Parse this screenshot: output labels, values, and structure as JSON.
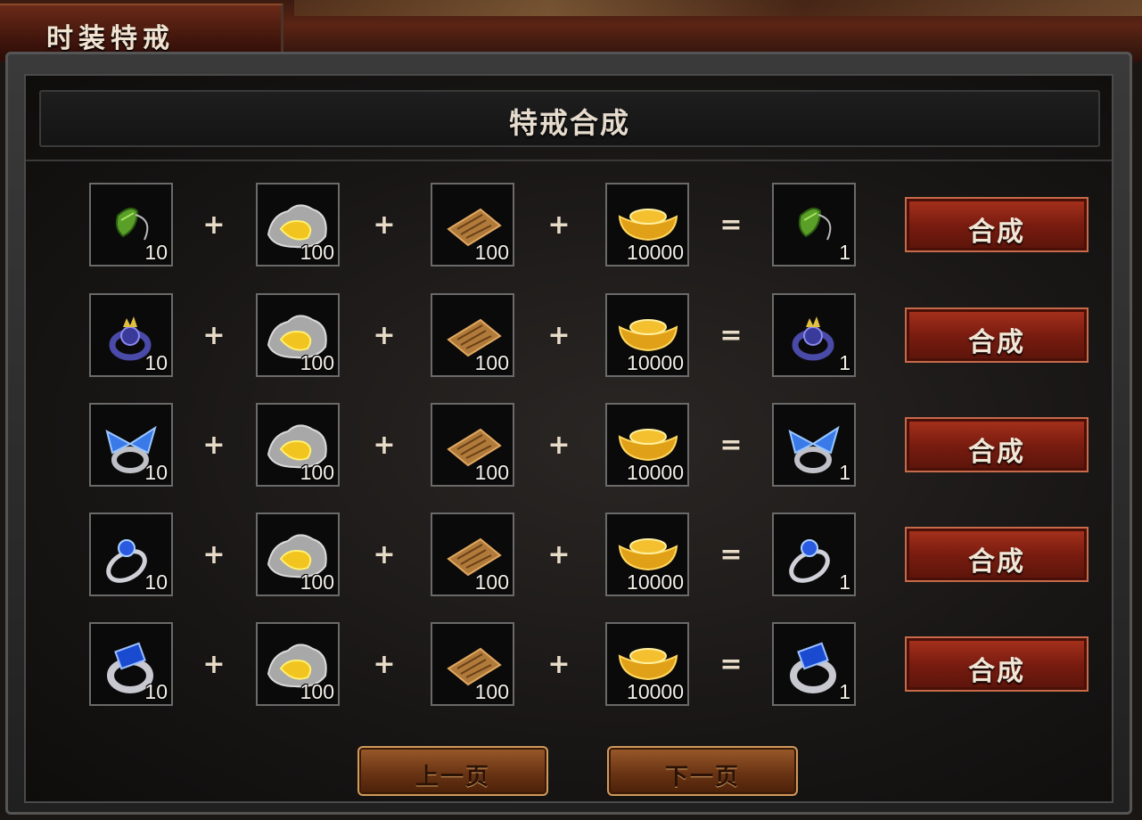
{
  "window": {
    "tab_title": "时装特戒"
  },
  "panel": {
    "title": "特戒合成"
  },
  "recipes": [
    {
      "ring": "green-leaf-pendant",
      "ring_qty": "10",
      "ore_qty": "100",
      "scroll_qty": "100",
      "gold_qty": "10000",
      "result_qty": "1",
      "craft_label": "合成"
    },
    {
      "ring": "violet-crown-ring",
      "ring_qty": "10",
      "ore_qty": "100",
      "scroll_qty": "100",
      "gold_qty": "10000",
      "result_qty": "1",
      "craft_label": "合成"
    },
    {
      "ring": "blue-butterfly-ring",
      "ring_qty": "10",
      "ore_qty": "100",
      "scroll_qty": "100",
      "gold_qty": "10000",
      "result_qty": "1",
      "craft_label": "合成"
    },
    {
      "ring": "sapphire-orb-ring",
      "ring_qty": "10",
      "ore_qty": "100",
      "scroll_qty": "100",
      "gold_qty": "10000",
      "result_qty": "1",
      "craft_label": "合成"
    },
    {
      "ring": "blue-gem-silver-ring",
      "ring_qty": "10",
      "ore_qty": "100",
      "scroll_qty": "100",
      "gold_qty": "10000",
      "result_qty": "1",
      "craft_label": "合成"
    }
  ],
  "operators": {
    "plus": "+",
    "equals": "="
  },
  "pagination": {
    "prev_label": "上一页",
    "next_label": "下一页"
  },
  "colors": {
    "craft_button": "#8a2414",
    "page_button": "#6a3414",
    "slot_border": "#6a6a6a"
  }
}
